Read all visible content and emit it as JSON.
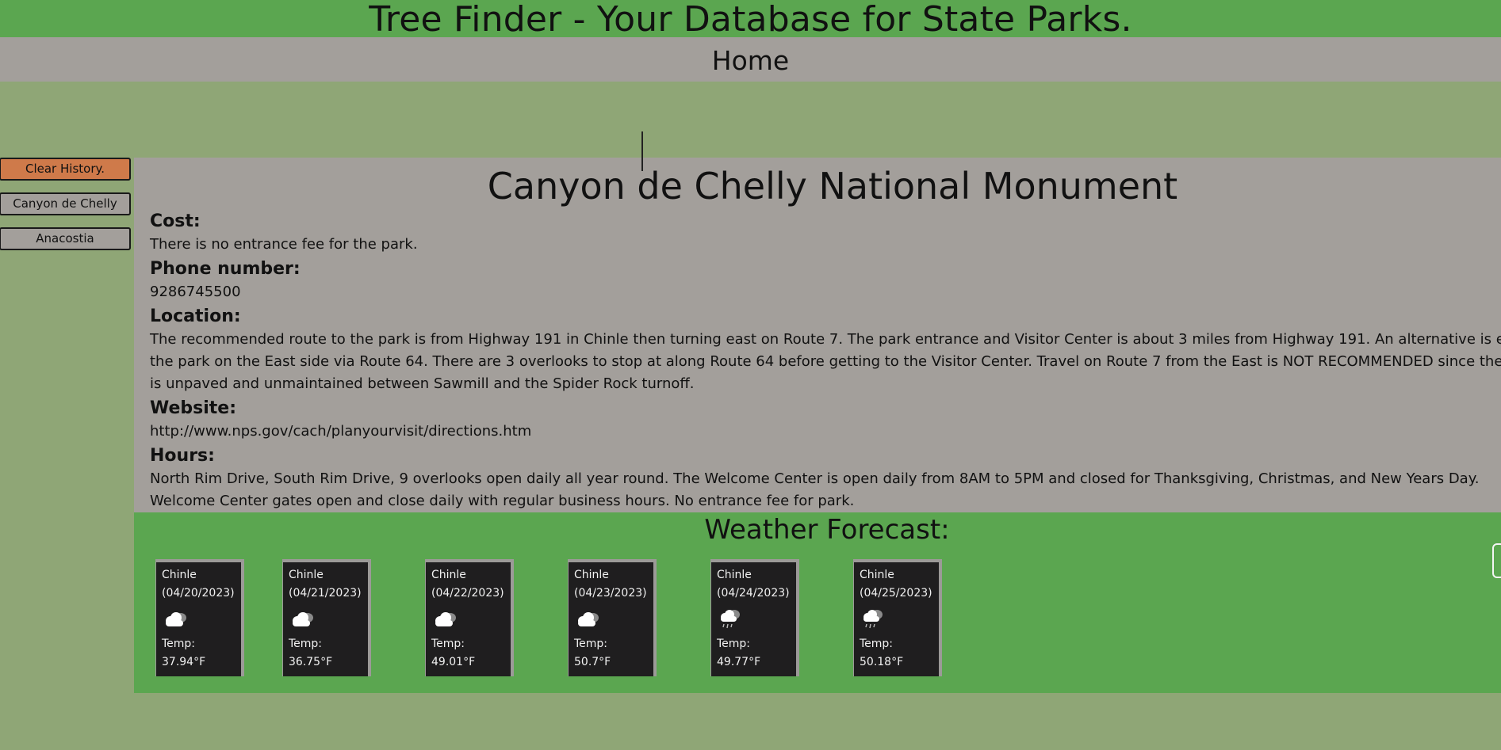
{
  "header": {
    "title": "Tree Finder - Your Database for State Parks.",
    "nav_label": "Home"
  },
  "sidebar": {
    "clear_label": "Clear History.",
    "history": [
      {
        "label": "Canyon de Chelly"
      },
      {
        "label": "Anacostia"
      }
    ]
  },
  "park": {
    "name": "Canyon de Chelly National Monument",
    "cost_label": "Cost:",
    "cost": "There is no entrance fee for the park.",
    "phone_label": "Phone number:",
    "phone": "9286745500",
    "location_label": "Location:",
    "location_lines": [
      "The recommended route to the park is from Highway 191 in Chinle then turning east on Route 7. The park entrance and Visitor Center is about 3 miles from Highway 191. An alternative is enterin",
      "the park on the East side via Route 64. There are 3 overlooks to stop at along Route 64 before getting to the Visitor Center. Travel on Route 7 from the East is NOT RECOMMENDED since the road",
      "is unpaved and unmaintained between Sawmill and the Spider Rock turnoff."
    ],
    "website_label": "Website:",
    "website": "http://www.nps.gov/cach/planyourvisit/directions.htm",
    "hours_label": "Hours:",
    "hours_lines": [
      "North Rim Drive, South Rim Drive, 9 overlooks open daily all year round. The Welcome Center is open daily from 8AM to 5PM and closed for Thanksgiving, Christmas, and New Years Day.",
      "Welcome Center gates open and close daily with regular business hours. No entrance fee for park."
    ]
  },
  "weather": {
    "title": "Weather Forecast:",
    "days": [
      {
        "city": "Chinle",
        "date": "(04/20/2023)",
        "icon": "cloudy-icon",
        "temp_label": "Temp:",
        "temp": "37.94°F"
      },
      {
        "city": "Chinle",
        "date": "(04/21/2023)",
        "icon": "cloudy-icon",
        "temp_label": "Temp:",
        "temp": "36.75°F"
      },
      {
        "city": "Chinle",
        "date": "(04/22/2023)",
        "icon": "cloudy-icon",
        "temp_label": "Temp:",
        "temp": "49.01°F"
      },
      {
        "city": "Chinle",
        "date": "(04/23/2023)",
        "icon": "cloudy-icon",
        "temp_label": "Temp:",
        "temp": "50.7°F"
      },
      {
        "city": "Chinle",
        "date": "(04/24/2023)",
        "icon": "rain-cloud-icon",
        "temp_label": "Temp:",
        "temp": "49.77°F"
      },
      {
        "city": "Chinle",
        "date": "(04/25/2023)",
        "icon": "rain-cloud-icon",
        "temp_label": "Temp:",
        "temp": "50.18°F"
      }
    ]
  },
  "colors": {
    "banner_green": "#5ba650",
    "page_background": "#8fa676",
    "panel_gray": "#a39f9b",
    "clear_button": "#cf7a4a",
    "card_background": "#1f1e1f"
  }
}
